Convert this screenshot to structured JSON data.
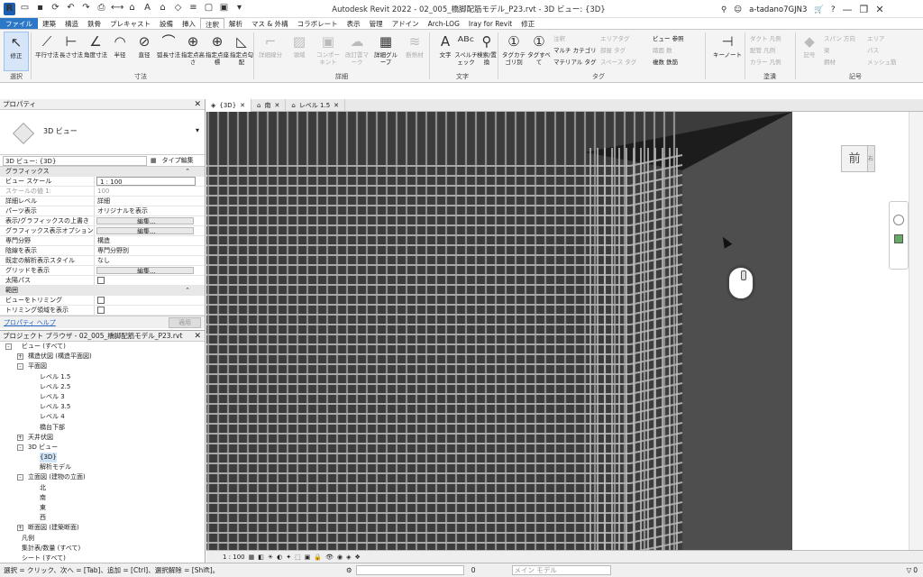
{
  "title_bar": {
    "title": "Autodesk Revit 2022 - 02_005_橋脚配筋モデル_P23.rvt - 3D ビュー: {3D}",
    "user": "a-tadano7GJN3"
  },
  "ribbon_tabs": [
    "ファイル",
    "建築",
    "構造",
    "鉄骨",
    "プレキャスト",
    "設備",
    "挿入",
    "注釈",
    "解析",
    "マス & 外構",
    "コラボレート",
    "表示",
    "管理",
    "アドイン",
    "Arch-LOG",
    "Iray for Revit",
    "修正"
  ],
  "active_tab": "注釈",
  "ribbon": {
    "select_label": "修正",
    "select_group": "選択",
    "dimension_buttons": [
      "平行寸法",
      "長さ寸法",
      "角度寸法",
      "半径",
      "直径",
      "弧長寸法",
      "指定点高さ",
      "指定点座標",
      "指定点勾配"
    ],
    "dimension_group": "寸法",
    "detail_buttons": [
      "詳細線分",
      "領域",
      "コンポーネント",
      "改訂雲マーク",
      "詳細グループ",
      "断熱材"
    ],
    "detail_group": "詳細",
    "text_buttons": [
      "文字",
      "スペルチェック",
      "検索/置換"
    ],
    "text_group": "文字",
    "tag_buttons": [
      "タグカテゴリ別",
      "タグすべて"
    ],
    "tag_small": [
      "注釈",
      "マルチ カテゴリ",
      "マテリアル タグ",
      "エリアタグ",
      "部屋 タグ",
      "スペース タグ",
      "ビュー 参照",
      "踏面 数",
      "複数 鉄筋"
    ],
    "tag_group": "タグ",
    "keynote": "キーノート",
    "color_fill_small": [
      "ダクト 凡例",
      "配管 凡例",
      "カラー 凡例"
    ],
    "color_fill_group": "塗潰",
    "symbol_button": "記号",
    "symbol_small": [
      "スパン 方向",
      "梁",
      "鋼材",
      "エリア",
      "パス",
      "メッシュ筋"
    ],
    "symbol_group": "記号"
  },
  "properties": {
    "header": "プロパティ",
    "type_name": "3D ビュー",
    "selector": "3D ビュー: {3D}",
    "type_edit": "タイプ編集",
    "section_graphics": "グラフィックス",
    "rows": [
      {
        "k": "ビュー スケール",
        "v": "1 : 100",
        "style": "box"
      },
      {
        "k": "スケールの値  1:",
        "v": "100",
        "style": "gray"
      },
      {
        "k": "詳細レベル",
        "v": "詳細",
        "style": ""
      },
      {
        "k": "パーツ表示",
        "v": "オリジナルを表示",
        "style": ""
      },
      {
        "k": "表示/グラフィックスの上書き",
        "v": "編集...",
        "style": "btn"
      },
      {
        "k": "グラフィックス表示オプション",
        "v": "編集...",
        "style": "btn"
      },
      {
        "k": "専門分野",
        "v": "構造",
        "style": ""
      },
      {
        "k": "陰線を表示",
        "v": "専門分野別",
        "style": ""
      },
      {
        "k": "既定の解析表示スタイル",
        "v": "なし",
        "style": ""
      },
      {
        "k": "グリッドを表示",
        "v": "編集...",
        "style": "btn"
      },
      {
        "k": "太陽パス",
        "v": "",
        "style": "chk"
      }
    ],
    "section_extents": "範囲",
    "rows2": [
      {
        "k": "ビューをトリミング",
        "v": "",
        "style": "chk"
      },
      {
        "k": "トリミング領域を表示",
        "v": "",
        "style": "chk"
      }
    ],
    "help_link": "プロパティ ヘルプ",
    "apply": "適用"
  },
  "project_browser": {
    "header": "プロジェクト ブラウザ - 02_005_橋脚配筋モデル_P23.rvt",
    "nodes": [
      {
        "label": "ビュー (すべて)",
        "level": 0,
        "pm": "-"
      },
      {
        "label": "構造伏図 (構造平面図)",
        "level": 1,
        "pm": "+"
      },
      {
        "label": "平面図",
        "level": 1,
        "pm": "-"
      },
      {
        "label": "レベル 1.5",
        "level": 2,
        "pm": ""
      },
      {
        "label": "レベル 2.5",
        "level": 2,
        "pm": ""
      },
      {
        "label": "レベル 3",
        "level": 2,
        "pm": ""
      },
      {
        "label": "レベル 3.5",
        "level": 2,
        "pm": ""
      },
      {
        "label": "レベル 4",
        "level": 2,
        "pm": ""
      },
      {
        "label": "橋台下部",
        "level": 2,
        "pm": ""
      },
      {
        "label": "天井伏図",
        "level": 1,
        "pm": "+"
      },
      {
        "label": "3D ビュー",
        "level": 1,
        "pm": "-"
      },
      {
        "label": "{3D}",
        "level": 2,
        "pm": "",
        "selected": true
      },
      {
        "label": "解析モデル",
        "level": 2,
        "pm": ""
      },
      {
        "label": "立面図 (建物の立面)",
        "level": 1,
        "pm": "-"
      },
      {
        "label": "北",
        "level": 2,
        "pm": ""
      },
      {
        "label": "南",
        "level": 2,
        "pm": ""
      },
      {
        "label": "東",
        "level": 2,
        "pm": ""
      },
      {
        "label": "西",
        "level": 2,
        "pm": ""
      },
      {
        "label": "断面図 (建築断面)",
        "level": 1,
        "pm": "+"
      },
      {
        "label": "凡例",
        "level": 0,
        "pm": ""
      },
      {
        "label": "集計表/数量 (すべて)",
        "level": 0,
        "pm": ""
      },
      {
        "label": "シート (すべて)",
        "level": 0,
        "pm": ""
      }
    ]
  },
  "view_tabs": [
    {
      "label": "{3D}",
      "active": true
    },
    {
      "label": "南",
      "active": false
    },
    {
      "label": "レベル 1.5",
      "active": false
    }
  ],
  "viewcube_face": "前",
  "view_scale": "1 : 100",
  "status": {
    "hint": "選択 = クリック、次へ = [Tab]、追加 = [Ctrl]、選択解除 = [Shift]。",
    "count": "0",
    "model": "メイン モデル",
    "filter_count": "0"
  }
}
